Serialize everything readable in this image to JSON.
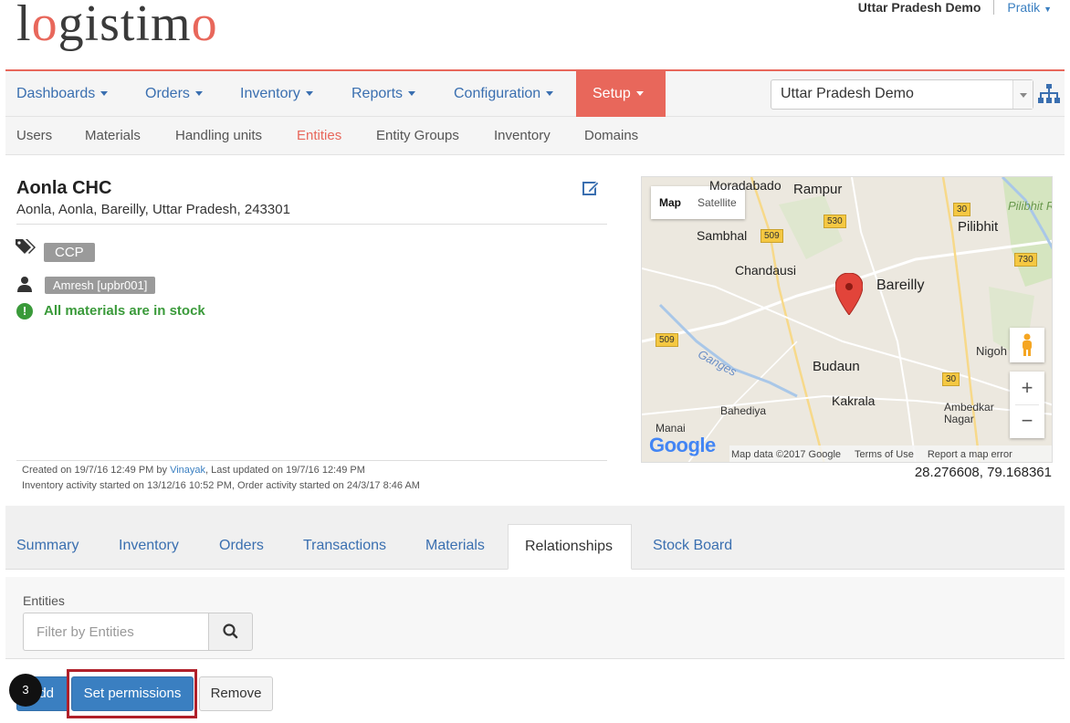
{
  "header": {
    "logo": "logistimo",
    "org_name": "Uttar Pradesh Demo",
    "user_name": "Pratik"
  },
  "main_nav": {
    "items": [
      "Dashboards",
      "Orders",
      "Inventory",
      "Reports",
      "Configuration",
      "Setup"
    ],
    "active": "Setup",
    "domain_selected": "Uttar Pradesh Demo"
  },
  "sub_nav": {
    "items": [
      "Users",
      "Materials",
      "Handling units",
      "Entities",
      "Entity Groups",
      "Inventory",
      "Domains"
    ],
    "active": "Entities"
  },
  "entity": {
    "name": "Aonla CHC",
    "address": "Aonla, Aonla, Bareilly, Uttar Pradesh, 243301",
    "tag": "CCP",
    "user": "Amresh [upbr001]",
    "stock_status": "All materials are in stock",
    "meta_created_prefix": "Created on 19/7/16 12:49 PM by ",
    "meta_created_by": "Vinayak",
    "meta_created_suffix": ", Last updated on 19/7/16 12:49 PM",
    "meta_activity": "Inventory activity started on 13/12/16 10:52 PM, Order activity started on 24/3/17 8:46 AM",
    "coordinates": "28.276608, 79.168361"
  },
  "map": {
    "tab_map": "Map",
    "tab_satellite": "Satellite",
    "places": [
      "Moradabado",
      "Rampur",
      "Pilibhit",
      "Sambhal",
      "Chandausi",
      "Bareilly",
      "Budaun",
      "Kakrala",
      "Bahediya",
      "Nigoh",
      "Ambedkar Nagar",
      "Manai",
      "Ganges"
    ],
    "shields": [
      "530",
      "509",
      "30",
      "730",
      "509",
      "30"
    ],
    "pilibhit_reserve": "Pilibhit Rese",
    "footer_logo": "Google",
    "footer_data": "Map data ©2017 Google",
    "footer_terms": "Terms of Use",
    "footer_report": "Report a map error"
  },
  "tabs": {
    "items": [
      "Summary",
      "Inventory",
      "Orders",
      "Transactions",
      "Materials",
      "Relationships",
      "Stock Board"
    ],
    "active": "Relationships"
  },
  "filter": {
    "label": "Entities",
    "placeholder": "Filter by Entities"
  },
  "actions": {
    "add": "Add",
    "add_visible": "dd",
    "set_permissions": "Set permissions",
    "remove": "Remove",
    "step_number": "3"
  },
  "colors": {
    "brand_red": "#e8675b",
    "link_blue": "#3a6fb0",
    "success_green": "#3a9a3a",
    "primary_button": "#3a7fc1",
    "highlight": "#b0202a"
  }
}
